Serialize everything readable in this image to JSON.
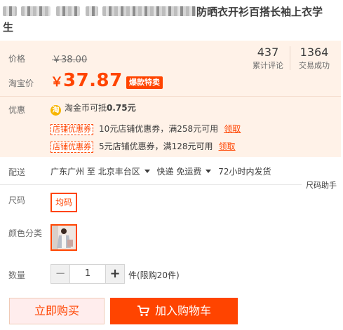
{
  "product": {
    "title_visible": "防晒衣开衫百搭长袖上衣学",
    "title_line2": "生"
  },
  "price": {
    "label": "价格",
    "original": "￥38.00",
    "promo_label": "淘宝价",
    "currency": "￥",
    "current": "37.87",
    "badge": "爆款特卖"
  },
  "stats": {
    "reviews_count": "437",
    "reviews_label": "累计评论",
    "sold_count": "1364",
    "sold_label": "交易成功"
  },
  "promo": {
    "label": "优惠",
    "coin_icon_text": "淘",
    "coin_text": "淘金币可抵",
    "coin_value": "0.75元",
    "coupons": [
      {
        "tag": "店铺优惠券",
        "desc": "10元店铺优惠券，满258元可用",
        "claim": "领取"
      },
      {
        "tag": "店铺优惠券",
        "desc": "5元店铺优惠券，满128元可用",
        "claim": "领取"
      }
    ]
  },
  "shipping": {
    "label": "配送",
    "from": "广东广州",
    "to_word": "至",
    "to": "北京丰台区",
    "method": "快递 免运费",
    "dispatch": "72小时内发货"
  },
  "size": {
    "label": "尺码",
    "help": "尺码助手",
    "option": "均码"
  },
  "color": {
    "label": "颜色分类"
  },
  "quantity": {
    "label": "数量",
    "minus": "−",
    "value": "1",
    "plus": "+",
    "note": "件(限购20件)"
  },
  "actions": {
    "buy_now": "立即购买",
    "add_to_cart": "加入购物车"
  },
  "colors": {
    "accent": "#ff4400",
    "price_bg": "#fff2e8"
  }
}
